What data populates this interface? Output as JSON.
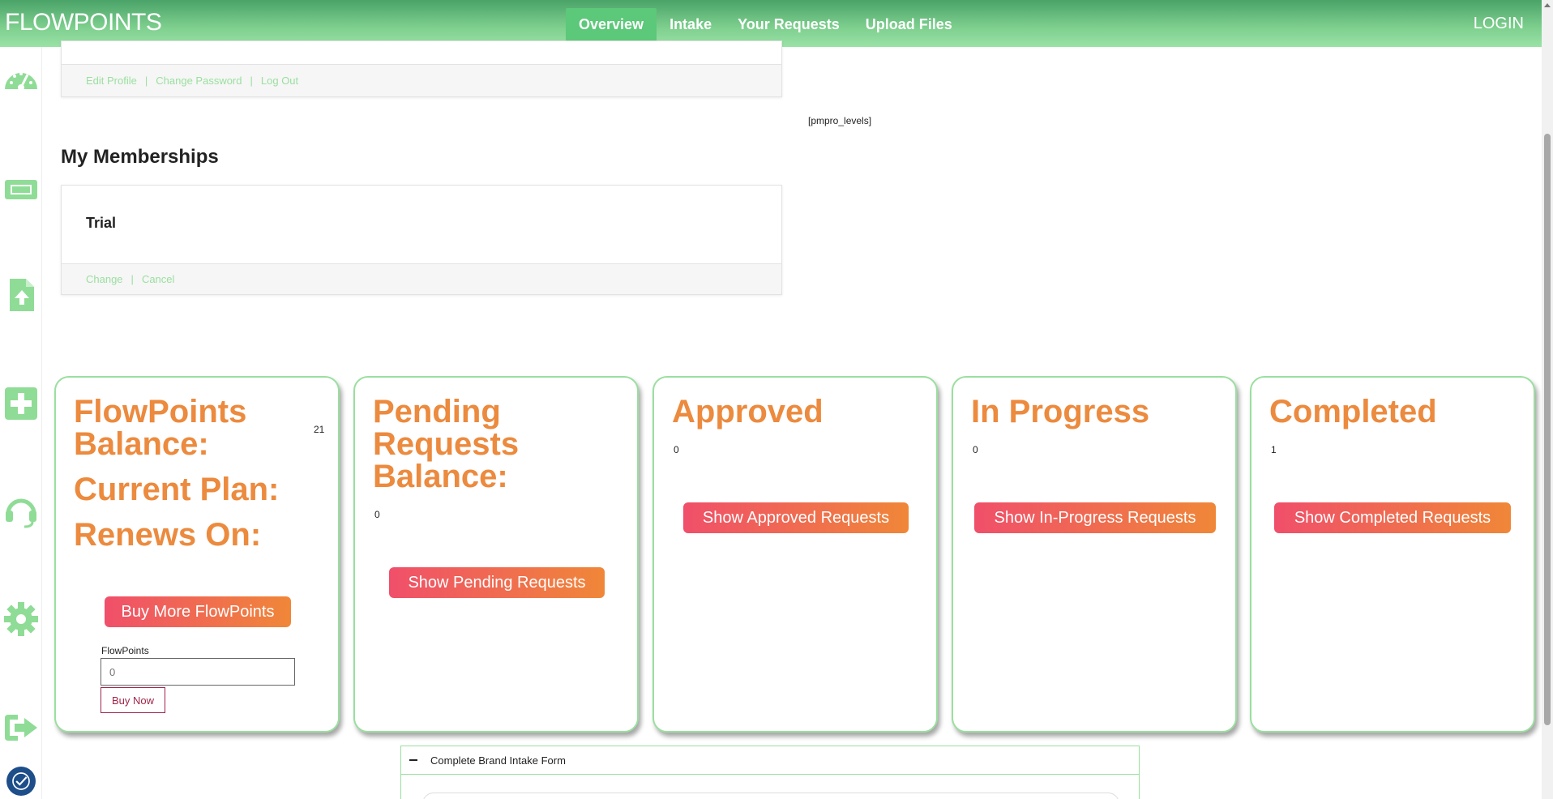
{
  "header": {
    "brand": "FLOWPOINTS",
    "nav": [
      {
        "label": "Overview",
        "active": true
      },
      {
        "label": "Intake",
        "active": false
      },
      {
        "label": "Your Requests",
        "active": false
      },
      {
        "label": "Upload Files",
        "active": false
      }
    ],
    "login": "LOGIN"
  },
  "rail": {
    "icons": [
      "dashboard-icon",
      "ticket-icon",
      "file-upload-icon",
      "plus-icon",
      "headset-icon",
      "gear-icon",
      "logout-icon"
    ],
    "accessibility": "accessibility-icon"
  },
  "profile": {
    "links": [
      "Edit Profile",
      "Change Password",
      "Log Out"
    ],
    "separator": "|"
  },
  "shortcode": "[pmpro_levels]",
  "memberships": {
    "title": "My Memberships",
    "plan": "Trial",
    "links": [
      "Change",
      "Cancel"
    ]
  },
  "stats": {
    "balance": {
      "title": "FlowPoints Balance:",
      "value": "21",
      "plan_label": "Current Plan:",
      "renews_label": "Renews On:",
      "button": "Buy More FlowPoints",
      "field_label": "FlowPoints",
      "field_placeholder": "0",
      "buy_now": "Buy Now"
    },
    "pending": {
      "title": "Pending Requests Balance:",
      "value": "0",
      "button": "Show Pending Requests"
    },
    "approved": {
      "title": "Approved",
      "value": "0",
      "button": "Show Approved Requests"
    },
    "in_progress": {
      "title": "In Progress",
      "value": "0",
      "button": "Show In-Progress Requests"
    },
    "completed": {
      "title": "Completed",
      "value": "1",
      "button": "Show Completed Requests"
    }
  },
  "accordion": {
    "label": "Complete Brand Intake Form"
  },
  "colors": {
    "brand_green": "#7fd08f",
    "accent_orange": "#ec8a3e",
    "button_start": "#f04f6a",
    "button_end": "#f08738",
    "link_green": "#9adf9f"
  }
}
